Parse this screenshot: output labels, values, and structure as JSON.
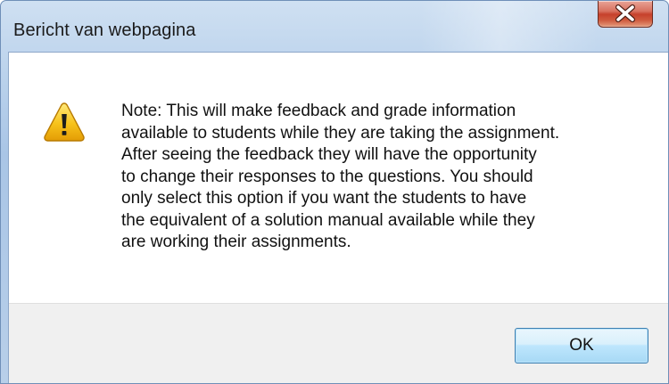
{
  "window": {
    "title": "Bericht van webpagina",
    "close_label": "X"
  },
  "message": {
    "icon": "warning-icon",
    "text": "Note: This will make feedback and grade information\navailable to students while they are taking the assignment.\nAfter seeing the feedback they will have the opportunity\nto change their responses to the questions. You should\nonly select this option if you want the students to have\nthe equivalent of a solution manual available while they\nare working their assignments."
  },
  "buttons": {
    "ok_label": "OK"
  },
  "colors": {
    "title_bar": "#b8cfe9",
    "close_button": "#c6412c",
    "button_bar": "#f0f0f0",
    "ok_border": "#3c7fb1"
  }
}
